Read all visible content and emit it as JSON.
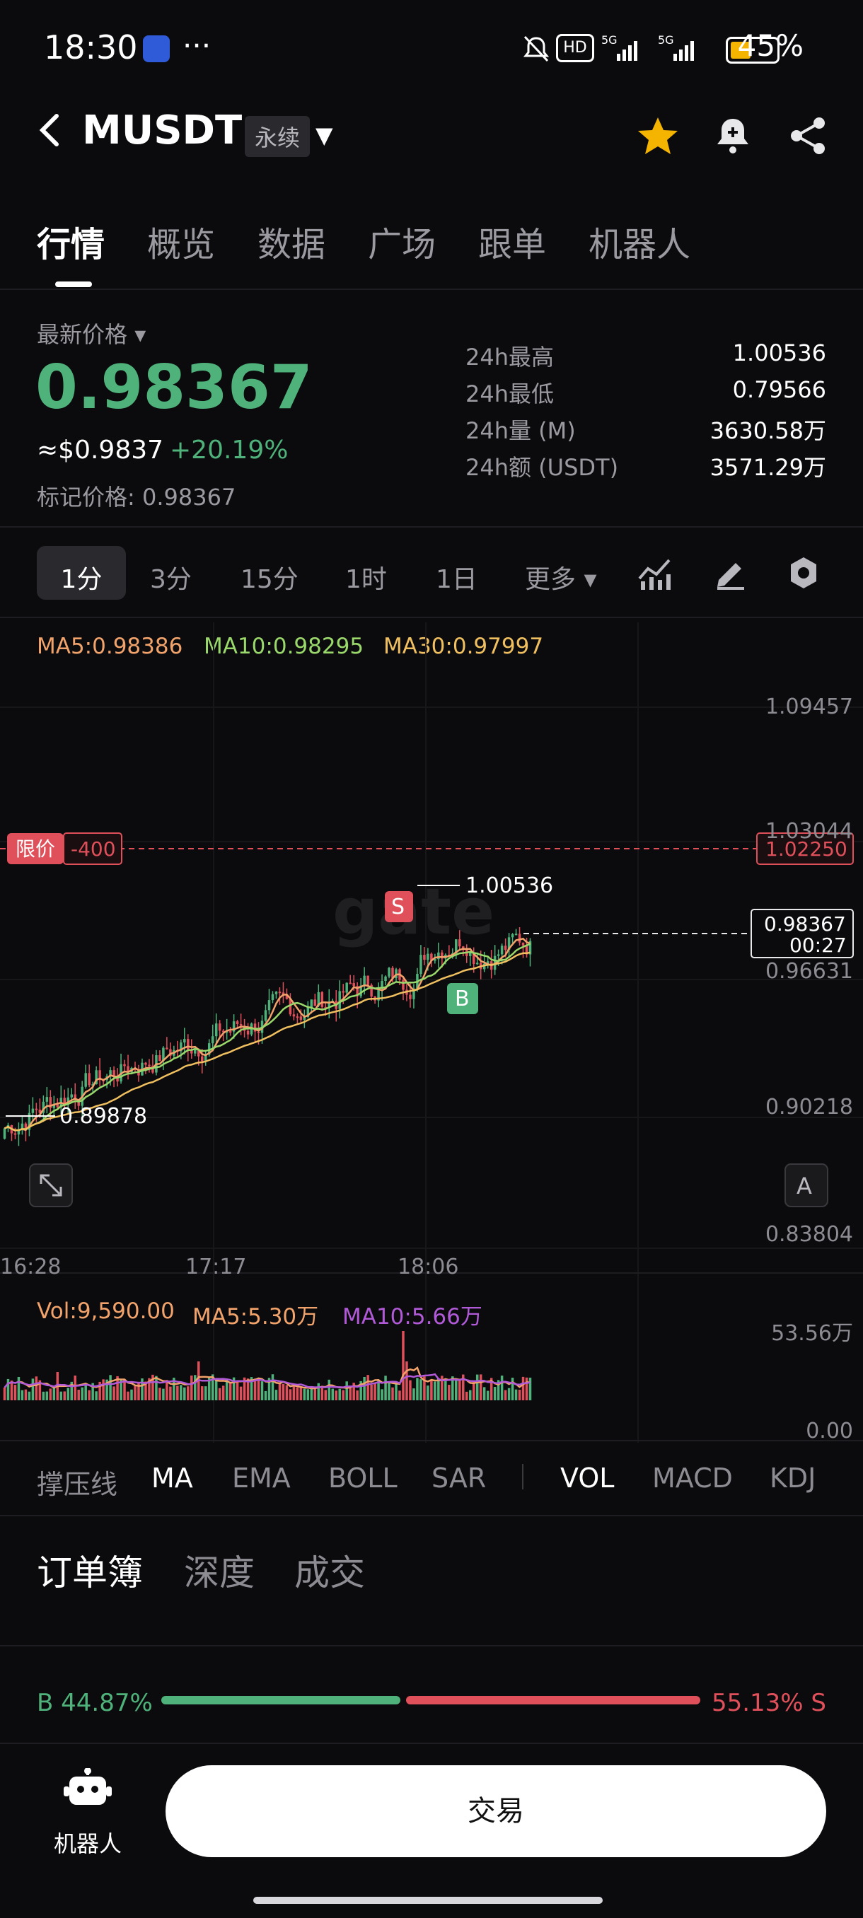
{
  "status_bar": {
    "time": "18:30",
    "dots": "···",
    "network": "HD 5G 5G",
    "battery_text": "45%",
    "battery_level": 0.45
  },
  "header": {
    "back_icon": "chevron-left-icon",
    "symbol": "MUSDT",
    "contract_type": "永续",
    "favorite_color": "#f5b400"
  },
  "tabs": [
    "行情",
    "概览",
    "数据",
    "广场",
    "跟单",
    "机器人"
  ],
  "price": {
    "label": "最新价格",
    "last": "0.98367",
    "usd": "≈$0.9837",
    "change": "+20.19%",
    "mark_label": "标记价格:",
    "mark_value": "0.98367"
  },
  "stats": [
    {
      "label": "24h最高",
      "value": "1.00536"
    },
    {
      "label": "24h最低",
      "value": "0.79566"
    },
    {
      "label": "24h量 (M)",
      "value": "3630.58万"
    },
    {
      "label": "24h额 (USDT)",
      "value": "3571.29万"
    }
  ],
  "intervals": [
    "1分",
    "3分",
    "15分",
    "1时",
    "1日",
    "更多"
  ],
  "ma": {
    "ma5": "MA5:0.98386",
    "ma10": "MA10:0.98295",
    "ma30": "MA30:0.97997",
    "ma5_color": "#f2a36b",
    "ma10_color": "#9ad86b",
    "ma30_color": "#f0c060"
  },
  "chart": {
    "y_ticks": [
      "1.09457",
      "1.03044",
      "0.96631",
      "0.90218",
      "0.83804"
    ],
    "x_ticks": [
      "16:28",
      "17:17",
      "18:06"
    ],
    "limit_tag": "限价",
    "limit_qty": "-400",
    "limit_price": "1.02250",
    "high_marker": "1.00536",
    "low_marker": "0.89878",
    "last_price_box": "0.98367",
    "countdown": "00:27",
    "sell_marker": "S",
    "buy_marker": "B",
    "watermark": "gate",
    "auto_scale": "A"
  },
  "volume": {
    "vol": "Vol:9,590.00",
    "ma5": "MA5:5.30万",
    "ma10": "MA10:5.66万",
    "y_top": "53.56万",
    "y_bottom": "0.00"
  },
  "indicators": [
    "撑压线",
    "MA",
    "EMA",
    "BOLL",
    "SAR",
    "VOL",
    "MACD",
    "KDJ"
  ],
  "orderbook": {
    "tabs": [
      "订单簿",
      "深度",
      "成交"
    ],
    "buy_ratio": "B 44.87%",
    "sell_ratio": "55.13% S",
    "buy_fraction": 0.4487
  },
  "bottom": {
    "robot_label": "机器人",
    "trade_label": "交易"
  },
  "colors": {
    "up": "#4fb27b",
    "down": "#e0505b",
    "limit": "#e0505b"
  }
}
